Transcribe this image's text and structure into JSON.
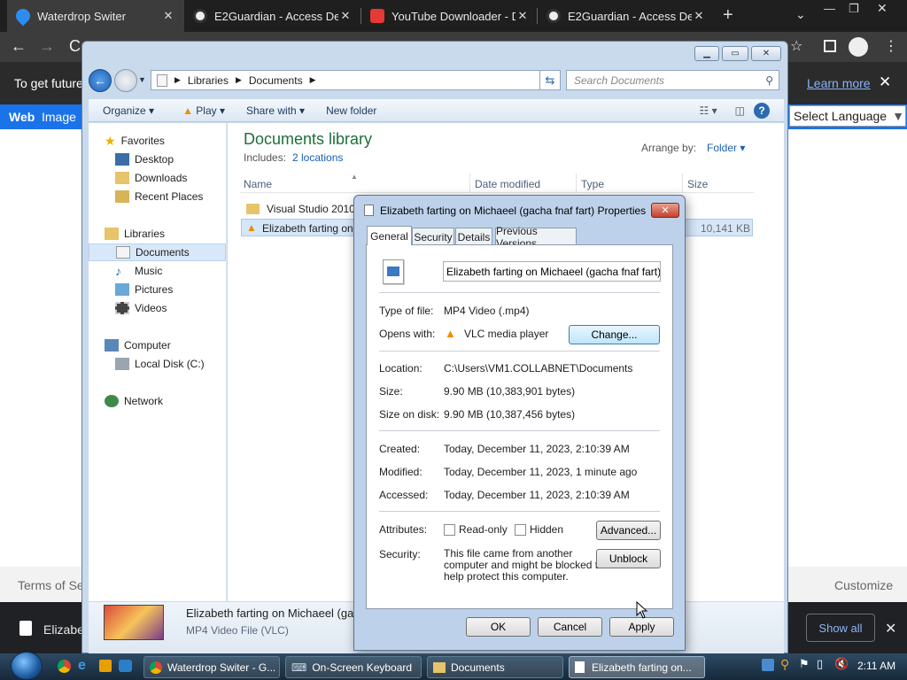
{
  "browser": {
    "tabs": [
      {
        "title": "Waterdrop Switer",
        "active": true
      },
      {
        "title": "E2Guardian - Access Den",
        "active": false
      },
      {
        "title": "YouTube Downloader - D",
        "active": false
      },
      {
        "title": "E2Guardian - Access Den",
        "active": false
      }
    ],
    "new_tab": "+",
    "infobar_text": "To get future",
    "learn_more": "Learn more",
    "nav_links": [
      "Web",
      "Image"
    ],
    "select_language": "Select Language",
    "footer_left": "Terms of Se",
    "footer_right": "Customize",
    "download": {
      "name": "Elizabe",
      "show_all": "Show all"
    }
  },
  "explorer": {
    "breadcrumb": [
      "Libraries",
      "Documents"
    ],
    "search_placeholder": "Search Documents",
    "commands": {
      "organize": "Organize",
      "play": "Play",
      "share": "Share with",
      "new_folder": "New folder"
    },
    "nav": {
      "favorites": "Favorites",
      "desktop": "Desktop",
      "downloads": "Downloads",
      "recent": "Recent Places",
      "libraries": "Libraries",
      "documents": "Documents",
      "music": "Music",
      "pictures": "Pictures",
      "videos": "Videos",
      "computer": "Computer",
      "local_disk": "Local Disk (C:)",
      "network": "Network"
    },
    "library_title": "Documents library",
    "includes_label": "Includes:",
    "includes_link": "2 locations",
    "arrange_label": "Arrange by:",
    "arrange_value": "Folder",
    "columns": [
      "Name",
      "Date modified",
      "Type",
      "Size"
    ],
    "files": [
      {
        "name": "Visual Studio 2010",
        "size": ""
      },
      {
        "name": "Elizabeth farting on",
        "size": "10,141 KB"
      }
    ],
    "details": {
      "name": "Elizabeth farting on Michaeel (ga",
      "type": "MP4 Video File (VLC)"
    }
  },
  "dialog": {
    "title": "Elizabeth farting on Michaeel (gacha fnaf fart) Properties",
    "tabs": [
      "General",
      "Security",
      "Details",
      "Previous Versions"
    ],
    "filename": "Elizabeth farting on Michaeel (gacha fnaf fart)",
    "labels": {
      "type": "Type of file:",
      "opens": "Opens with:",
      "location": "Location:",
      "size": "Size:",
      "size_disk": "Size on disk:",
      "created": "Created:",
      "modified": "Modified:",
      "accessed": "Accessed:",
      "attributes": "Attributes:",
      "security": "Security:"
    },
    "values": {
      "type": "MP4 Video (.mp4)",
      "opens": "VLC media player",
      "location": "C:\\Users\\VM1.COLLABNET\\Documents",
      "size": "9.90 MB (10,383,901 bytes)",
      "size_disk": "9.90 MB (10,387,456 bytes)",
      "created": "Today, December 11, 2023, 2:10:39 AM",
      "modified": "Today, December 11, 2023, 1 minute ago",
      "accessed": "Today, December 11, 2023, 2:10:39 AM",
      "security_line1": "This file came from another",
      "security_line2": "computer and might be blocked to",
      "security_line3": "help protect this computer."
    },
    "buttons": {
      "change": "Change...",
      "advanced": "Advanced...",
      "unblock": "Unblock",
      "ok": "OK",
      "cancel": "Cancel",
      "apply": "Apply"
    },
    "attributes": {
      "readonly": "Read-only",
      "hidden": "Hidden"
    }
  },
  "taskbar": {
    "items": [
      "Waterdrop Switer - G...",
      "On-Screen Keyboard",
      "Documents",
      "Elizabeth farting on..."
    ],
    "clock": "2:11 AM"
  }
}
